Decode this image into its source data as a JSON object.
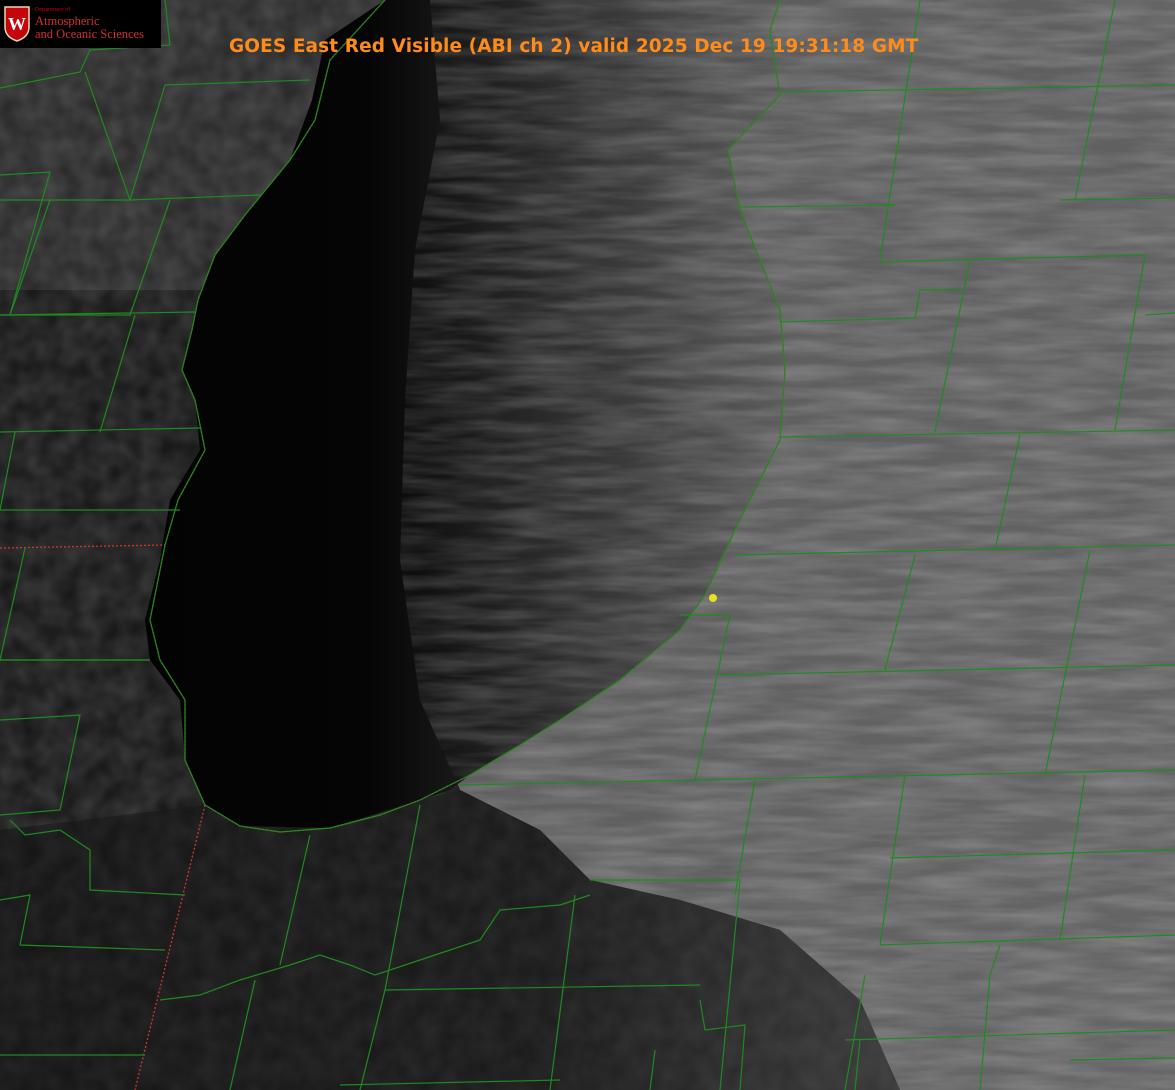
{
  "title": "GOES East Red Visible (ABI ch 2) valid 2025 Dec 19 19:31:18 GMT",
  "logo": {
    "department": "Department of",
    "line1": "Atmospheric",
    "line2": "and Oceanic Sciences",
    "crest_letter": "W"
  },
  "colors": {
    "title": "#ff8c1a",
    "county_borders": "#1f8a1f",
    "state_border": "#c83a2a",
    "marker": "#e8e21a",
    "logo_red": "#c5050c",
    "lake": "#050505",
    "land_dark": "#1a1a1a",
    "cloud_gray": "#6a6a6a"
  },
  "imagery": {
    "product": "satellite-visible-image",
    "features": [
      "lake",
      "lake-effect-cloud-bands",
      "county-borders",
      "state-border",
      "point-marker"
    ]
  }
}
